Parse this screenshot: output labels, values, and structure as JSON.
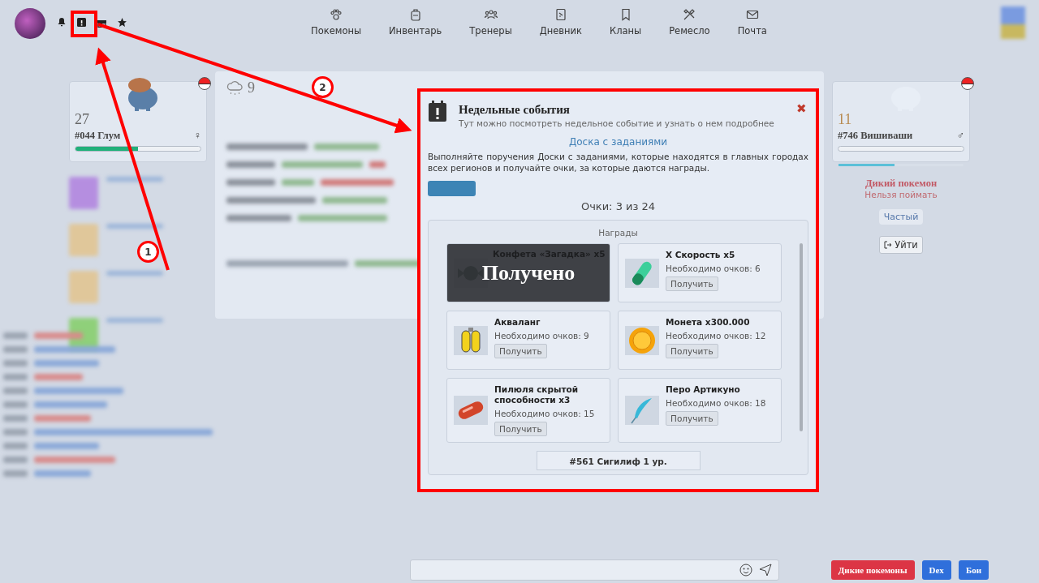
{
  "top_bar": {
    "nav": [
      {
        "label": "Покемоны",
        "kind": "paw"
      },
      {
        "label": "Инвентарь",
        "kind": "bag"
      },
      {
        "label": "Тренеры",
        "kind": "people"
      },
      {
        "label": "Дневник",
        "kind": "journal"
      },
      {
        "label": "Кланы",
        "kind": "bookmark"
      },
      {
        "label": "Ремесло",
        "kind": "tools"
      },
      {
        "label": "Почта",
        "kind": "mail"
      }
    ]
  },
  "player_pokemon": {
    "level_text": "27",
    "name": "#044 Глум",
    "gender": "♀",
    "hp": {
      "level": 0.5
    }
  },
  "weather": {
    "value": "9"
  },
  "wild_pokemon": {
    "level_text": "11",
    "name": "#746 Вишиваши",
    "gender": "♂",
    "exp": {
      "level": 0.45
    },
    "status": "Дикий покемон",
    "note": "Нельзя поймать",
    "rarity": "Частый",
    "leave_button": "Уйти"
  },
  "bottom_buttons": [
    {
      "label": "Дикие покемоны",
      "color": "#dc3545"
    },
    {
      "label": "Dex",
      "color": "#2f6fdb"
    },
    {
      "label": "Бои",
      "color": "#2f6fdb"
    }
  ],
  "modal": {
    "title": "Недельные события",
    "subtitle": "Тут можно посмотреть недельное событие и узнать о нем подробнее",
    "close": "✖",
    "link": "Доска с заданиями",
    "description": "Выполняйте поручения Доски с заданиями, которые находятся в главных городах всех регионов и получайте очки, за которые даются награды.",
    "points": "Очки: 3 из 24",
    "rewards": {
      "title": "Награды",
      "items": [
        {
          "kind": "candy",
          "name": "Конфета «Загадка» x5",
          "claimed": true,
          "claimed_label": "Получено"
        },
        {
          "kind": "green-pill",
          "name": "X Скорость x5",
          "requirement": "Необходимо очков: 6",
          "button": "Получить",
          "claimed": false
        },
        {
          "kind": "tanks",
          "name": "Акваланг",
          "requirement": "Необходимо очков: 9",
          "button": "Получить",
          "claimed": false
        },
        {
          "kind": "coin",
          "name": "Монета x300.000",
          "requirement": "Необходимо очков: 12",
          "button": "Получить",
          "claimed": false
        },
        {
          "kind": "red-pill",
          "name": "Пилюля скрытой способности x3",
          "requirement": "Необходимо очков: 15",
          "button": "Получить",
          "claimed": false
        },
        {
          "kind": "feather",
          "name": "Перо Артикуно",
          "requirement": "Необходимо очков: 18",
          "button": "Получить",
          "claimed": false
        }
      ],
      "next": "#561 Сигилиф 1 ур."
    }
  },
  "annotations": [
    {
      "label": "1"
    },
    {
      "label": "2"
    }
  ]
}
